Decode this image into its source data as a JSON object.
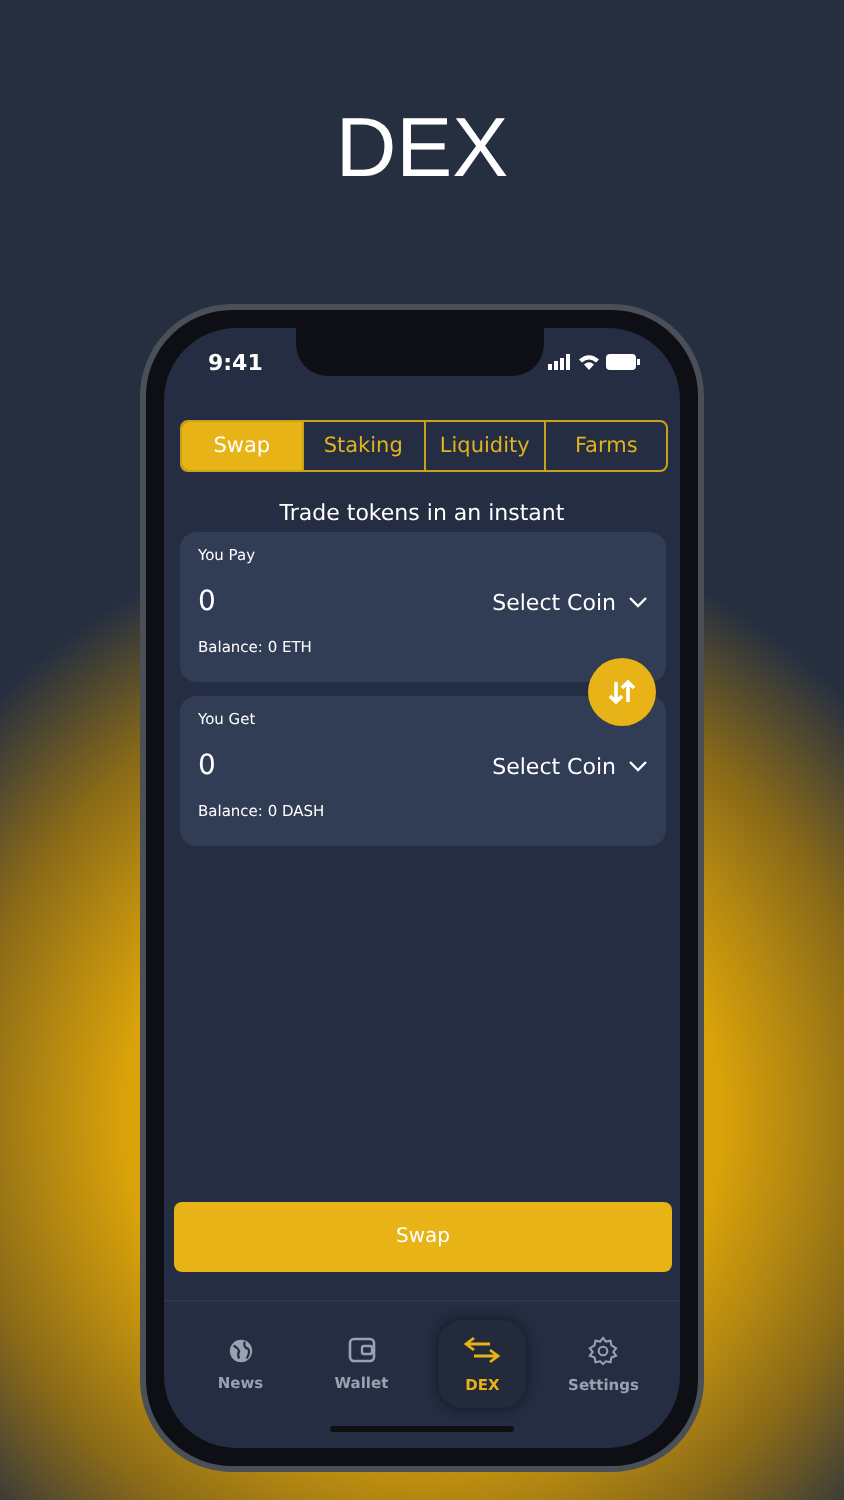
{
  "title": "DEX",
  "status_bar": {
    "time": "9:41"
  },
  "tabs": [
    {
      "label": "Swap",
      "selected": true
    },
    {
      "label": "Staking",
      "selected": false
    },
    {
      "label": "Liquidity",
      "selected": false
    },
    {
      "label": "Farms",
      "selected": false
    }
  ],
  "heading": "Trade tokens in an instant",
  "cards": [
    {
      "label": "You Pay",
      "amount": "0",
      "selector": "Select Coin",
      "balance": "Balance: 0 ETH"
    },
    {
      "label": "You Get",
      "amount": "0",
      "selector": "Select Coin",
      "balance": "Balance: 0 DASH"
    }
  ],
  "swap_button": "Swap",
  "nav": [
    {
      "kind": "globe",
      "label": "News",
      "selected": false
    },
    {
      "kind": "wallet",
      "label": "Wallet",
      "selected": false
    },
    {
      "kind": "swap",
      "label": "DEX",
      "selected": true
    },
    {
      "kind": "gear",
      "label": "Settings",
      "selected": false
    }
  ]
}
